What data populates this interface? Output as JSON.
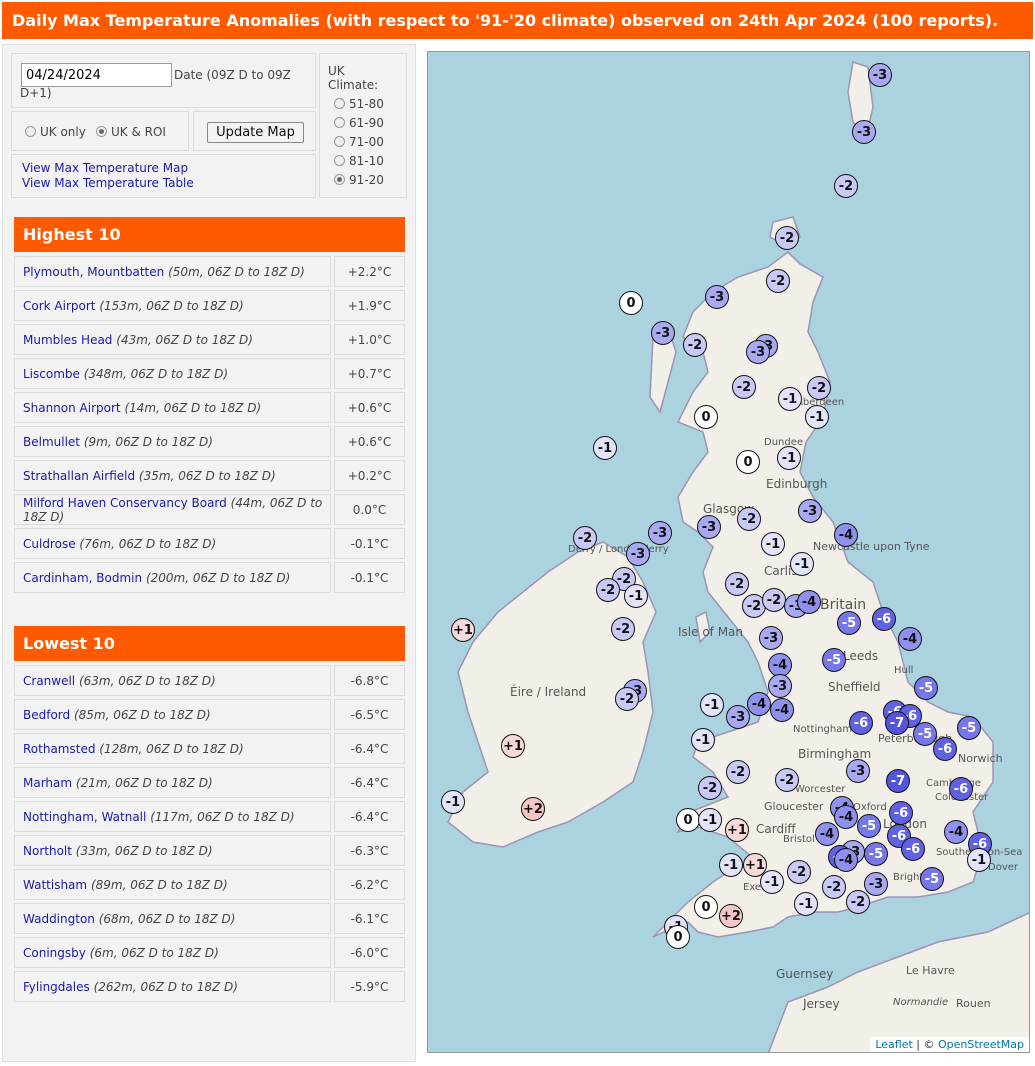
{
  "title": "Daily Max Temperature Anomalies (with respect to '91-'20 climate) observed on 24th Apr 2024 (100 reports).",
  "controls": {
    "date_value": "04/24/2024",
    "date_caption_1": "Date (09Z D to 09Z",
    "date_caption_2": "D+1)",
    "uk_only": "UK only",
    "uk_roi": "UK & ROI",
    "update_button": "Update Map",
    "link_map": "View Max Temperature Map",
    "link_table": "View Max Temperature Table",
    "climate_head_1": "UK",
    "climate_head_2": "Climate:",
    "climate_options": [
      "51-80",
      "61-90",
      "71-00",
      "81-10",
      "91-20"
    ],
    "climate_selected": "91-20"
  },
  "highest": {
    "heading": "Highest 10",
    "rows": [
      {
        "site": "Plymouth, Mountbatten",
        "meta": "(50m, 06Z D to 18Z D)",
        "value": "+2.2°C"
      },
      {
        "site": "Cork Airport",
        "meta": "(153m, 06Z D to 18Z D)",
        "value": "+1.9°C"
      },
      {
        "site": "Mumbles Head",
        "meta": "(43m, 06Z D to 18Z D)",
        "value": "+1.0°C"
      },
      {
        "site": "Liscombe",
        "meta": "(348m, 06Z D to 18Z D)",
        "value": "+0.7°C"
      },
      {
        "site": "Shannon Airport",
        "meta": "(14m, 06Z D to 18Z D)",
        "value": "+0.6°C"
      },
      {
        "site": "Belmullet",
        "meta": "(9m, 06Z D to 18Z D)",
        "value": "+0.6°C"
      },
      {
        "site": "Strathallan Airfield",
        "meta": "(35m, 06Z D to 18Z D)",
        "value": "+0.2°C"
      },
      {
        "site": "Milford Haven Conservancy Board",
        "meta": "(44m, 06Z D to 18Z D)",
        "value": "0.0°C"
      },
      {
        "site": "Culdrose",
        "meta": "(76m, 06Z D to 18Z D)",
        "value": "-0.1°C"
      },
      {
        "site": "Cardinham, Bodmin",
        "meta": "(200m, 06Z D to 18Z D)",
        "value": "-0.1°C"
      }
    ]
  },
  "lowest": {
    "heading": "Lowest 10",
    "rows": [
      {
        "site": "Cranwell",
        "meta": "(63m, 06Z D to 18Z D)",
        "value": "-6.8°C"
      },
      {
        "site": "Bedford",
        "meta": "(85m, 06Z D to 18Z D)",
        "value": "-6.5°C"
      },
      {
        "site": "Rothamsted",
        "meta": "(128m, 06Z D to 18Z D)",
        "value": "-6.4°C"
      },
      {
        "site": "Marham",
        "meta": "(21m, 06Z D to 18Z D)",
        "value": "-6.4°C"
      },
      {
        "site": "Nottingham, Watnall",
        "meta": "(117m, 06Z D to 18Z D)",
        "value": "-6.4°C"
      },
      {
        "site": "Northolt",
        "meta": "(33m, 06Z D to 18Z D)",
        "value": "-6.3°C"
      },
      {
        "site": "Wattisham",
        "meta": "(89m, 06Z D to 18Z D)",
        "value": "-6.2°C"
      },
      {
        "site": "Waddington",
        "meta": "(68m, 06Z D to 18Z D)",
        "value": "-6.1°C"
      },
      {
        "site": "Coningsby",
        "meta": "(6m, 06Z D to 18Z D)",
        "value": "-6.0°C"
      },
      {
        "site": "Fylingdales",
        "meta": "(262m, 06Z D to 18Z D)",
        "value": "-5.9°C"
      }
    ]
  },
  "map": {
    "attribution_leaflet": "Leaflet",
    "attribution_sep": " | © ",
    "attribution_osm": "OpenStreetMap",
    "place_labels": [
      "Edinburgh",
      "Glasgow",
      "Newcastle upon Tyne",
      "Carlisle",
      "Isle of Man",
      "Leeds",
      "Sheffield",
      "Nottingham",
      "Birmingham",
      "Peterborough",
      "Norwich",
      "Cardiff",
      "Gloucester",
      "Bristol",
      "London",
      "Brighton",
      "Exeter",
      "Guernsey",
      "Jersey",
      "Le Havre",
      "Rouen",
      "Dundee",
      "Aberdeen",
      "Derry / Londonderry",
      "Éire / Ireland",
      "Britain",
      "Hull",
      "Colchester",
      "Cambridge",
      "Worcester",
      "Oxford",
      "Southend-on-Sea",
      "Dover",
      "Normandie"
    ],
    "colors": {
      "sea": "#aad3df",
      "land": "#f2efe9",
      "neutral": "#ffffff",
      "warm1": "#f7d9d9",
      "warm2": "#f4c6c6",
      "cool1": "#e3e3fa",
      "cool2": "#c9c9f6",
      "cool3": "#a9a9f2",
      "cool4": "#9090ee",
      "cool5": "#7777ea",
      "cool6": "#6161e4",
      "cool7": "#5454de"
    }
  }
}
